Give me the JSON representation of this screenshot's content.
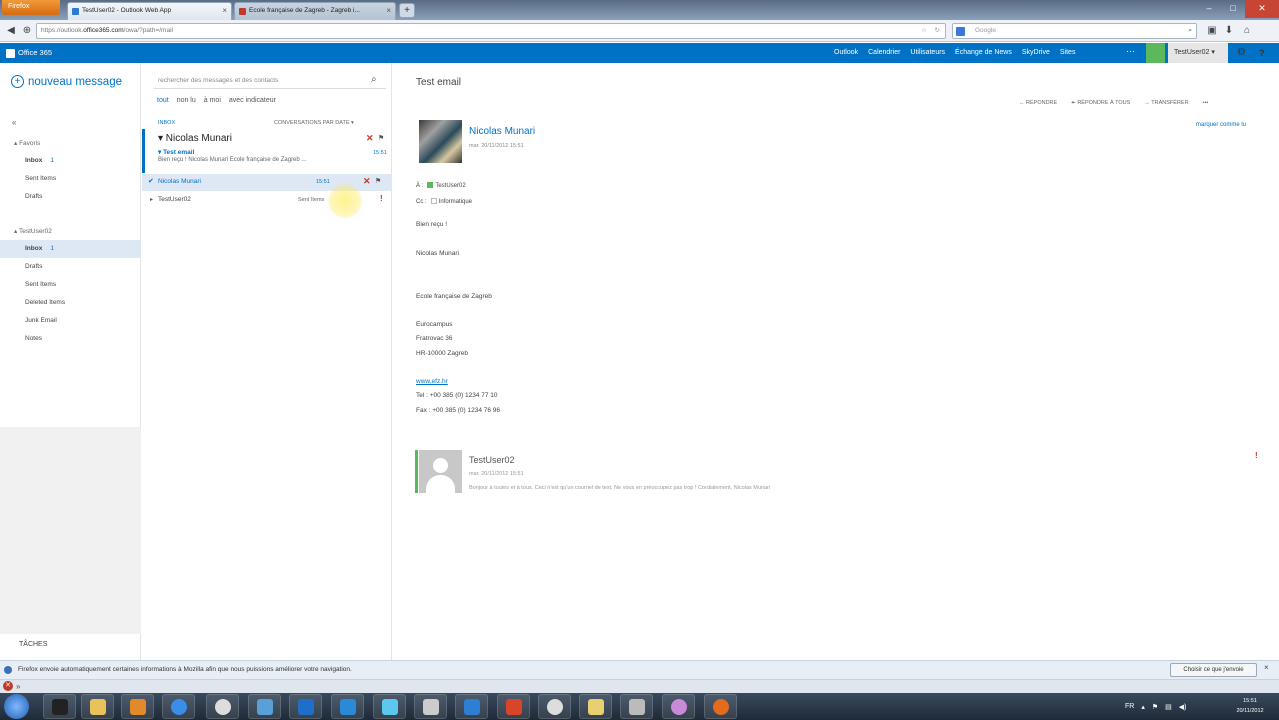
{
  "browser": {
    "menu_label": "Firefox",
    "tabs": [
      {
        "label": "TestUser02 - Outlook Web App",
        "close": "×"
      },
      {
        "label": "Ecole française de Zagreb - Zagreb i...",
        "close": "×"
      }
    ],
    "new_tab": "+",
    "url_prefix": "https://outlook.",
    "url_domain": "office365.com",
    "url_suffix": "/owa/?path=/mail",
    "search_placeholder": "Google",
    "win_min": "–",
    "win_max": "□",
    "win_close": "✕"
  },
  "o365": {
    "logo_label": "Office 365",
    "nav": [
      "Outlook",
      "Calendrier",
      "Utilisateurs",
      "Échange de News",
      "SkyDrive",
      "Sites"
    ],
    "more": "···",
    "user": "TestUser02 ▾",
    "gear": "⚙",
    "help": "?"
  },
  "left": {
    "new_message": "nouveau message",
    "collapse": "«",
    "favorites_header": "▴ Favoris",
    "favorites": [
      {
        "name": "Inbox",
        "count": "1"
      },
      {
        "name": "Sent Items",
        "count": ""
      },
      {
        "name": "Drafts",
        "count": ""
      }
    ],
    "account_header": "▴ TestUser02",
    "folders": [
      {
        "name": "Inbox",
        "count": "1"
      },
      {
        "name": "Drafts",
        "count": ""
      },
      {
        "name": "Sent Items",
        "count": ""
      },
      {
        "name": "Deleted Items",
        "count": ""
      },
      {
        "name": "Junk Email",
        "count": ""
      },
      {
        "name": "Notes",
        "count": ""
      }
    ],
    "tasks": "TÂCHES"
  },
  "list": {
    "search_placeholder": "rechercher des messages et des contacts",
    "filters": [
      "tout",
      "non lu",
      "à moi",
      "avec indicateur"
    ],
    "folder_label": "INBOX",
    "sort_label": "CONVERSATIONS PAR DATE ▾",
    "rows": [
      {
        "sender": "▾ Nicolas Munari",
        "subject": "▾ Test email",
        "preview": "Bien reçu ! Nicolas Munari  Ecole française de Zagreb ...",
        "time": "15:51"
      },
      {
        "sender": "Nicolas Munari",
        "folder": "",
        "time": "15:51"
      },
      {
        "sender": "TestUser02",
        "folder": "Sent Items",
        "time": ""
      }
    ]
  },
  "reading": {
    "subject": "Test email",
    "actions": [
      "← RÉPONDRE",
      "↞ RÉPONDRE À TOUS",
      "→ TRANSFÉRER",
      "•••"
    ],
    "mark_read": "marquer comme lu",
    "sender": "Nicolas Munari",
    "sent": "mar. 20/11/2012 15:51",
    "to_label": "À :",
    "to": "TestUser02",
    "cc_label": "Cc :",
    "cc": "Informatique",
    "body": [
      "Bien reçu !",
      "Nicolas Munari",
      "Ecole française de Zagreb",
      "Eurocampus",
      "Fratrovac 36",
      "HR-10000 Zagreb"
    ],
    "link": "www.efz.hr",
    "tel": "Tel : +00 385 (0) 1234 77 10",
    "fax": "Fax : +00 385 (0) 1234 76 96",
    "reply_sender": "TestUser02",
    "reply_date": "mar. 20/11/2012 15:51",
    "reply_preview": "Bonjour à toutes et à tous. Ceci n'est qu'un courriel de test. Ne vous en préoccupez pas trop ! Cordialement, Nicolas Munari",
    "importance": "!"
  },
  "notification": {
    "text": "Firefox envoie automatiquement certaines informations à Mozilla afin que nous puissions améliorer votre navigation.",
    "button": "Choisir ce que j'envoie",
    "close": "×"
  },
  "taskbar": {
    "clock_time": "15:51",
    "clock_date": "20/11/2012",
    "lang": "FR"
  },
  "colors": {
    "o365_blue": "#0072c6",
    "presence_green": "#5cb85c",
    "delete_red": "#c0392b"
  }
}
